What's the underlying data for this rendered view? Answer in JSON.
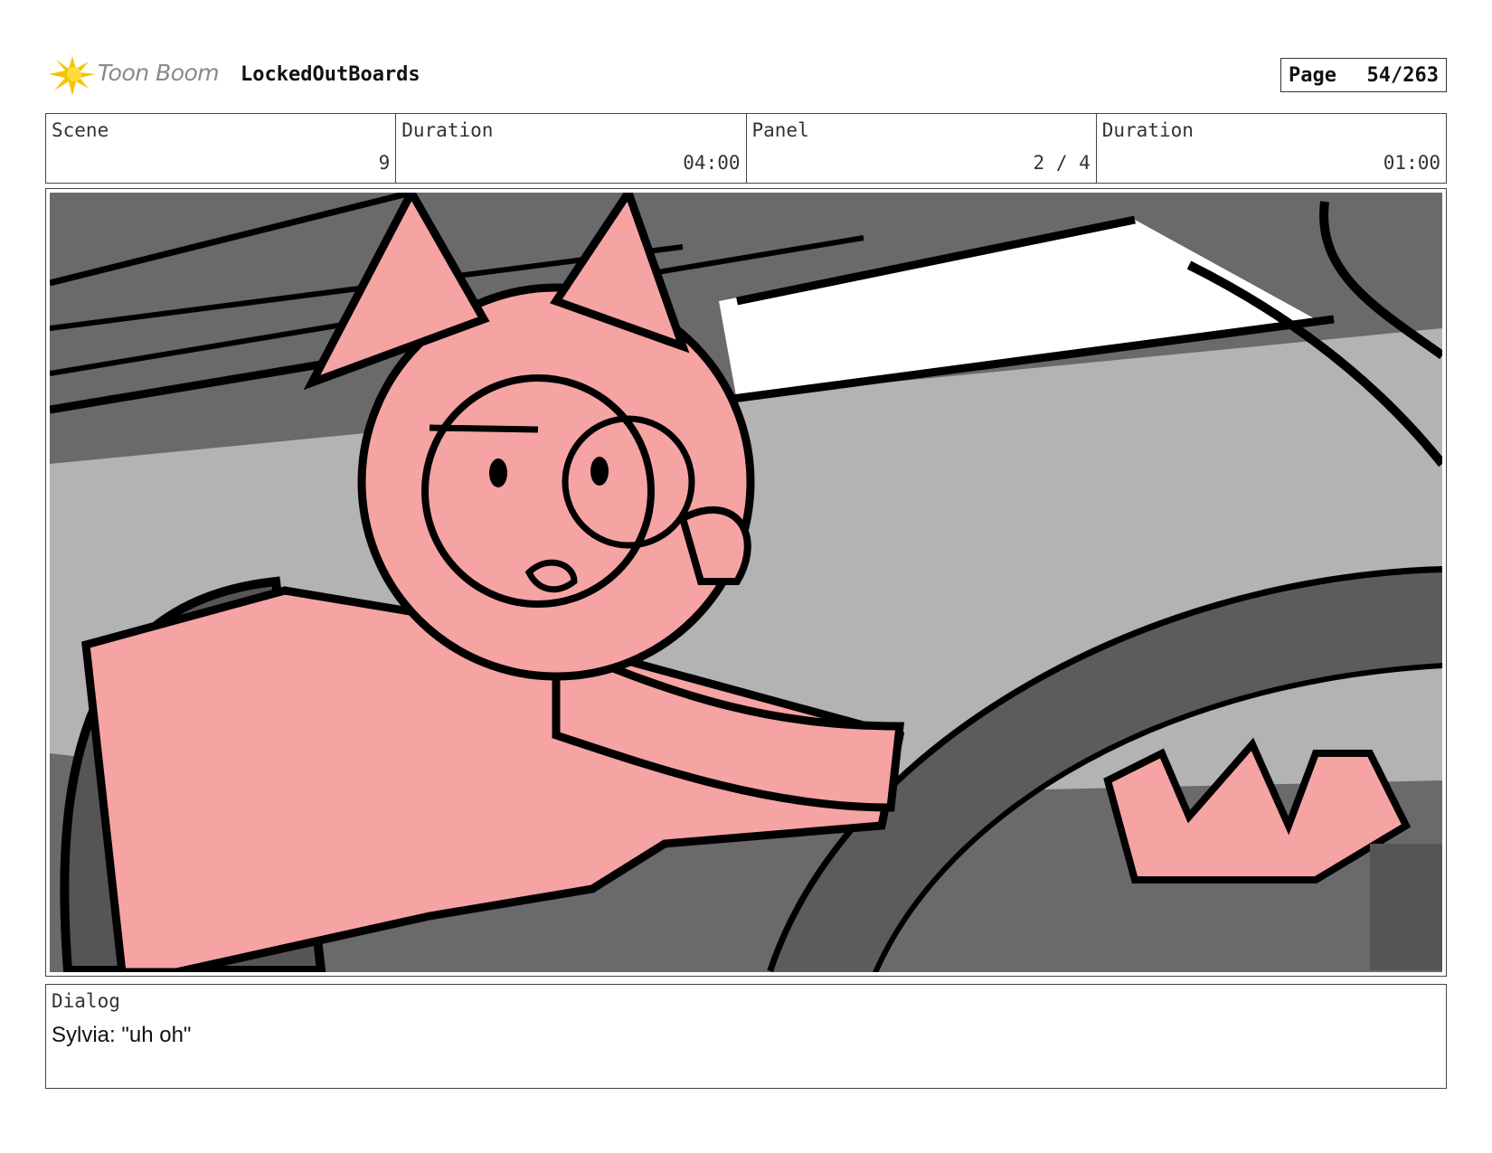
{
  "header": {
    "logo_text": "Toon Boom",
    "project_title": "LockedOutBoards",
    "page_label": "Page",
    "page_number": "54/263"
  },
  "info": {
    "scene_label": "Scene",
    "scene_value": "9",
    "scene_duration_label": "Duration",
    "scene_duration_value": "04:00",
    "panel_label": "Panel",
    "panel_value": "2 / 4",
    "panel_duration_label": "Duration",
    "panel_duration_value": "01:00"
  },
  "dialog": {
    "label": "Dialog",
    "text": "Sylvia: \"uh oh\""
  },
  "colors": {
    "character_fill": "#f6a3a3",
    "background_gray": "#6a6a6a",
    "window_light": "#b3b3b3",
    "logo_yellow": "#f5c400"
  }
}
